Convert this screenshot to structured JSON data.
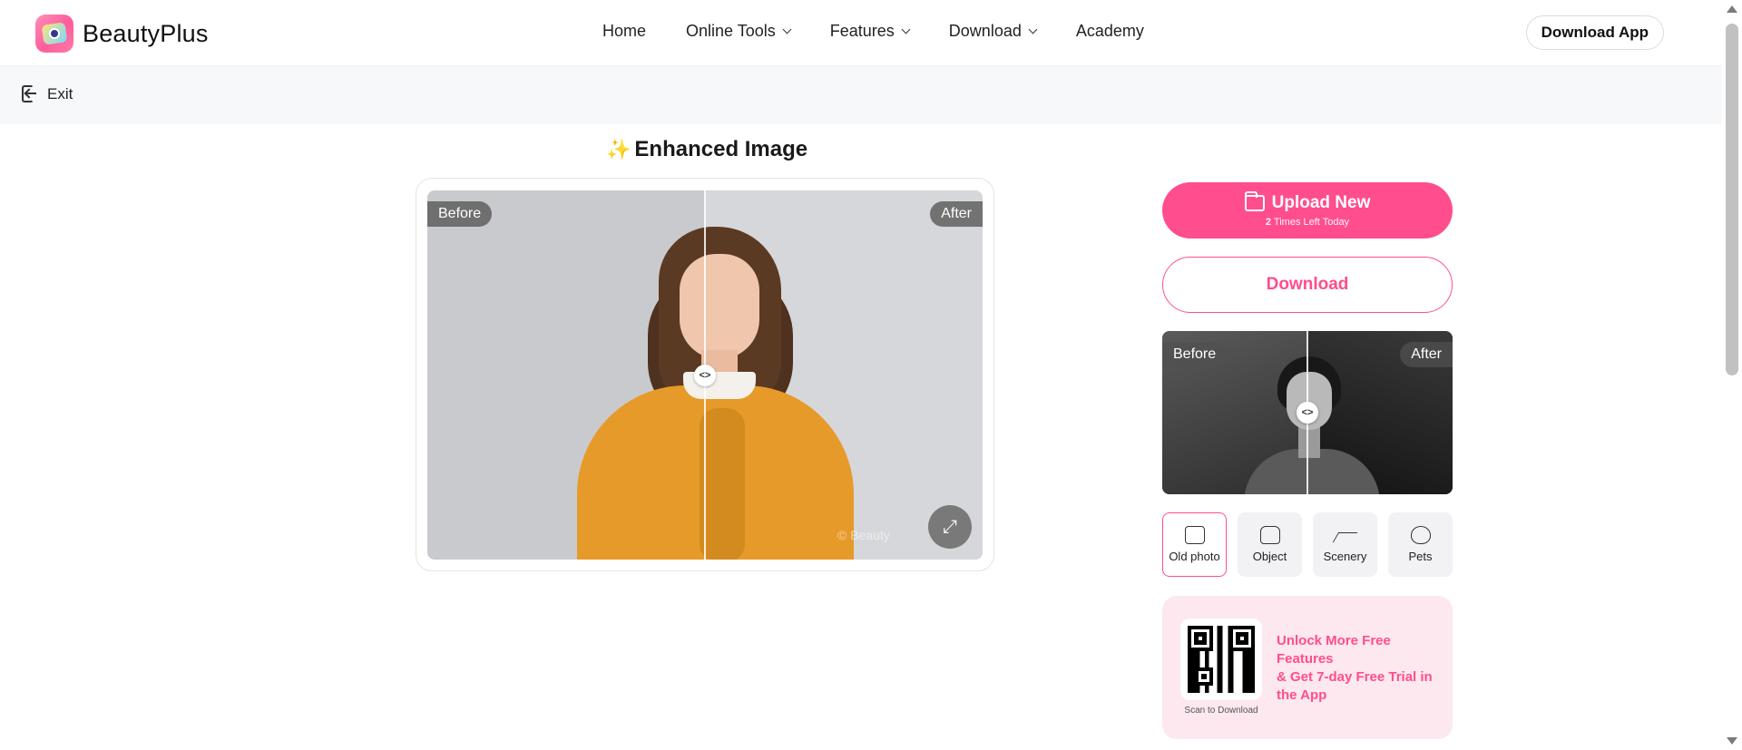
{
  "header": {
    "brand": "BeautyPlus",
    "nav": [
      {
        "label": "Home",
        "dropdown": false
      },
      {
        "label": "Online Tools",
        "dropdown": true
      },
      {
        "label": "Features",
        "dropdown": true
      },
      {
        "label": "Download",
        "dropdown": true
      },
      {
        "label": "Academy",
        "dropdown": false
      }
    ],
    "download_app": "Download App"
  },
  "subbar": {
    "exit_label": "Exit"
  },
  "main": {
    "title_icon": "✨",
    "title": "Enhanced Image",
    "before_label": "Before",
    "after_label": "After",
    "watermark": "© Beauty"
  },
  "panel": {
    "upload_label": "Upload New",
    "upload_count": "2",
    "upload_sub": "Times Left Today",
    "download_label": "Download",
    "sample_before": "Before",
    "sample_after": "After",
    "tools": [
      {
        "label": "Old photo",
        "icon": "old-photo-icon",
        "active": true
      },
      {
        "label": "Object",
        "icon": "object-icon",
        "active": false
      },
      {
        "label": "Scenery",
        "icon": "scenery-icon",
        "active": false
      },
      {
        "label": "Pets",
        "icon": "pets-icon",
        "active": false
      }
    ],
    "promo": {
      "line1": "Unlock More Free Features",
      "line2": "& Get 7-day Free Trial in the App",
      "qr_caption": "Scan to Download"
    }
  },
  "colors": {
    "accent": "#ff4d8d",
    "promo_bg": "#fde8ef"
  }
}
